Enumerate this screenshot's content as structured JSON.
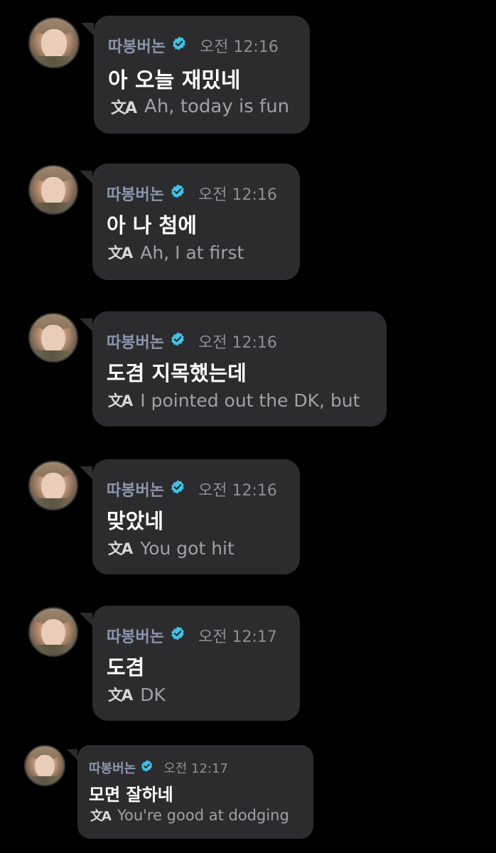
{
  "messages": [
    {
      "username": "따봉버논",
      "time": "오전 12:16",
      "text": "아 오늘 재밌네",
      "translation": "Ah, today is fun"
    },
    {
      "username": "따봉버논",
      "time": "오전 12:16",
      "text": "아 나 첨에",
      "translation": "Ah, I at first"
    },
    {
      "username": "따봉버논",
      "time": "오전 12:16",
      "text": "도겸 지목했는데",
      "translation": "I pointed out the DK, but"
    },
    {
      "username": "따봉버논",
      "time": "오전 12:16",
      "text": "맞았네",
      "translation": "You got hit"
    },
    {
      "username": "따봉버논",
      "time": "오전 12:17",
      "text": "도겸",
      "translation": "DK"
    },
    {
      "username": "따봉버논",
      "time": "오전 12:17",
      "text": "모면 잘하네",
      "translation": "You're good at dodging"
    }
  ],
  "icons": {
    "verified": "verified-badge-icon",
    "translate": "translate-icon"
  },
  "colors": {
    "background": "#000000",
    "bubble": "#2c2c2e",
    "username": "#8b95ad",
    "verified": "#3fc3e6",
    "message": "#ffffff",
    "translation": "#a1a1a6"
  },
  "translate_glyph": "文A"
}
